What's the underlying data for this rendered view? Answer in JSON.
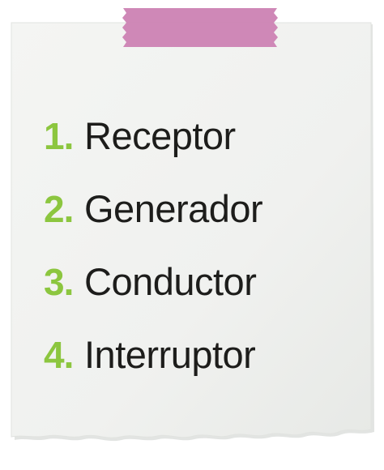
{
  "colors": {
    "background": "#ffffff",
    "paper": "#f1f2f0",
    "paper_shadow": "#d9dbd8",
    "tape": "#cc82b3",
    "number": "#8cc63f",
    "text": "#1d1d1b"
  },
  "list": {
    "items": [
      {
        "number": "1.",
        "label": "Receptor"
      },
      {
        "number": "2.",
        "label": "Generador"
      },
      {
        "number": "3.",
        "label": "Conductor"
      },
      {
        "number": "4.",
        "label": "Interruptor"
      }
    ]
  }
}
